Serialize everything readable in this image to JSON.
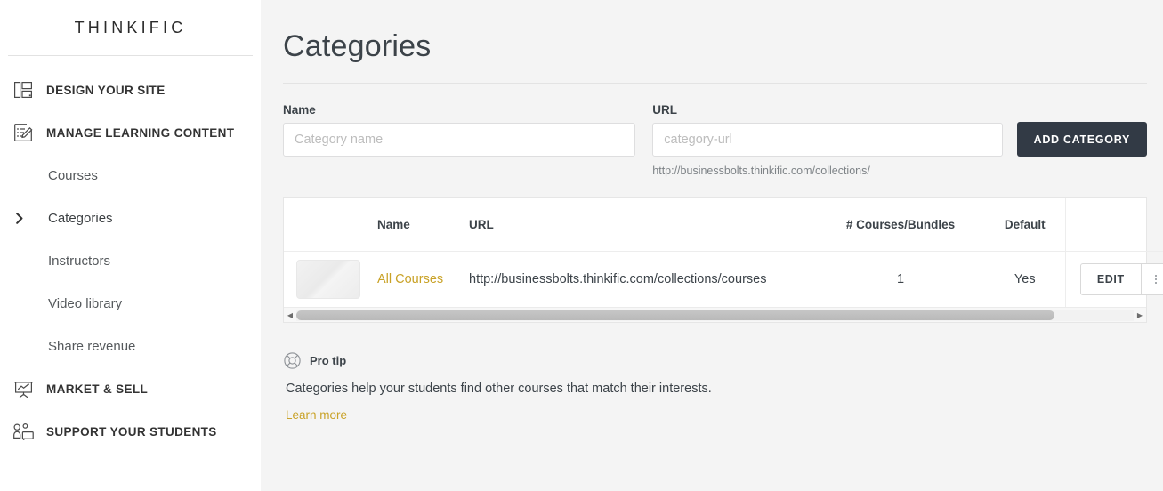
{
  "brand": {
    "name": "THINKIFIC"
  },
  "sidebar": {
    "items": [
      {
        "label": "DESIGN YOUR SITE",
        "icon": "layout-icon",
        "type": "section"
      },
      {
        "label": "MANAGE LEARNING CONTENT",
        "icon": "edit-list-icon",
        "type": "section"
      },
      {
        "label": "Courses",
        "type": "sub"
      },
      {
        "label": "Categories",
        "type": "sub",
        "expander": "chevron-right-icon"
      },
      {
        "label": "Instructors",
        "type": "sub"
      },
      {
        "label": "Video library",
        "type": "sub"
      },
      {
        "label": "Share revenue",
        "type": "sub"
      },
      {
        "label": "MARKET & SELL",
        "icon": "presentation-chart-icon",
        "type": "section"
      },
      {
        "label": "SUPPORT YOUR STUDENTS",
        "icon": "users-icon",
        "type": "section"
      }
    ]
  },
  "page": {
    "title": "Categories"
  },
  "form": {
    "name_label": "Name",
    "name_value": "",
    "name_placeholder": "Category name",
    "url_label": "URL",
    "url_value": "",
    "url_placeholder": "category-url",
    "url_helper": "http://businessbolts.thinkific.com/collections/",
    "add_button": "ADD CATEGORY"
  },
  "table": {
    "headers": {
      "thumb": "",
      "name": "Name",
      "url": "URL",
      "count": "# Courses/Bundles",
      "default": "Default",
      "actions": ""
    },
    "rows": [
      {
        "name": "All Courses",
        "url": "http://businessbolts.thinkific.com/collections/courses",
        "count": "1",
        "default": "Yes",
        "edit_label": "EDIT",
        "menu_icon": "kebab-menu-icon"
      }
    ],
    "scroll_left_icon": "caret-left-icon",
    "scroll_right_icon": "caret-right-icon"
  },
  "protip": {
    "icon": "lifebuoy-icon",
    "label": "Pro tip",
    "body": "Categories help your students find other courses that match their interests.",
    "link": "Learn more"
  },
  "colors": {
    "accent_gold": "#c9a227",
    "button_dark": "#323a45",
    "page_bg": "#f4f4f4",
    "sidebar_bg": "#ffffff",
    "text": "#3c4349"
  }
}
